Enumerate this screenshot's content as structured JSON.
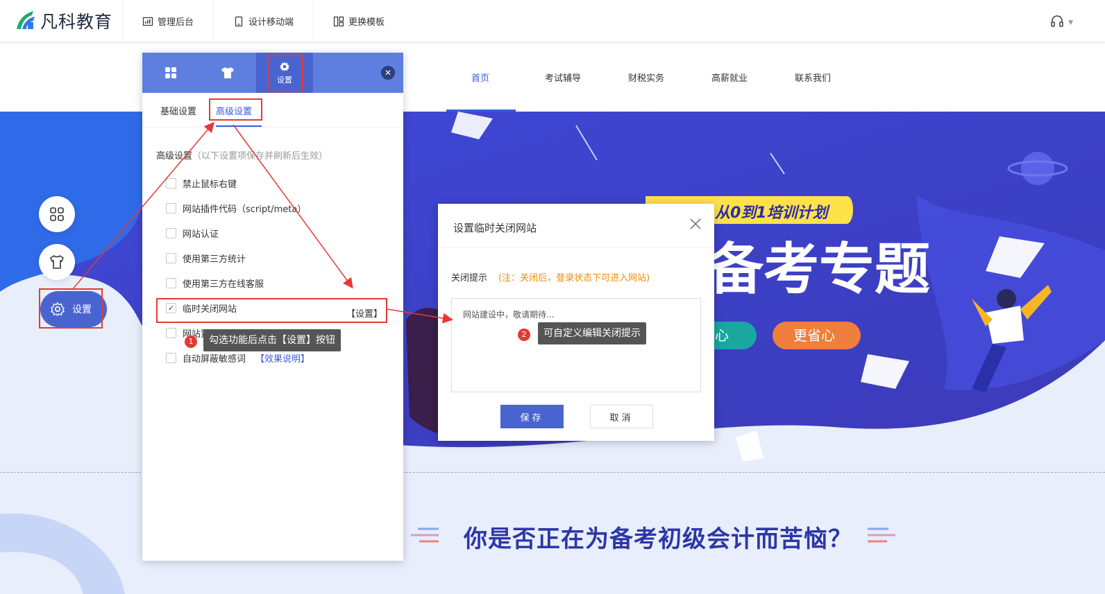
{
  "app": {
    "logo_text": "凡科教育"
  },
  "topnav": [
    {
      "label": "管理后台",
      "icon": "chart-icon"
    },
    {
      "label": "设计移动端",
      "icon": "mobile-icon"
    },
    {
      "label": "更换模板",
      "icon": "template-icon"
    }
  ],
  "site": {
    "nav": [
      "首页",
      "考试辅导",
      "财税实务",
      "高薪就业",
      "联系我们"
    ],
    "banner_ribbon": "从0到1培训计划",
    "banner_title": "备考专题",
    "banner_btn_left": "心",
    "banner_btn_right": "更省心",
    "section_title": "你是否正在为备考初级会计而苦恼？"
  },
  "float_buttons": {
    "setting_label": "设置"
  },
  "panel": {
    "tab_settings_label": "设置",
    "subtabs": [
      "基础设置",
      "高级设置"
    ],
    "adv_title": "高级设置",
    "adv_note": "（以下设置项保存并刷新后生效）",
    "options": [
      {
        "label": "禁止鼠标右键",
        "checked": false
      },
      {
        "label": "网站插件代码（script/meta）",
        "checked": false
      },
      {
        "label": "网站认证",
        "checked": false
      },
      {
        "label": "使用第三方统计",
        "checked": false
      },
      {
        "label": "使用第三方在线客服",
        "checked": false
      },
      {
        "label": "临时关闭网站",
        "checked": true
      },
      {
        "label": "网站置页面",
        "checked": false
      },
      {
        "label": "自动屏蔽敏感词",
        "checked": false
      }
    ],
    "close_site_setting": "【设置】",
    "effect_link": "【效果说明】"
  },
  "tips": {
    "tip1": "勾选功能后点击【设置】按钮",
    "tip2": "可自定义编辑关闭提示",
    "badge1": "1",
    "badge2": "2"
  },
  "modal": {
    "title": "设置临时关闭网站",
    "label": "关闭提示",
    "note": "(注：关闭后，登录状态下可进入网站)",
    "textarea_value": "网站建设中，敬请期待...",
    "save": "保存",
    "cancel": "取消"
  },
  "colors": {
    "accent": "#4a64cf",
    "header_blue": "#5e7fe0",
    "annotation_red": "#e53935",
    "note_orange": "#f08c00"
  }
}
